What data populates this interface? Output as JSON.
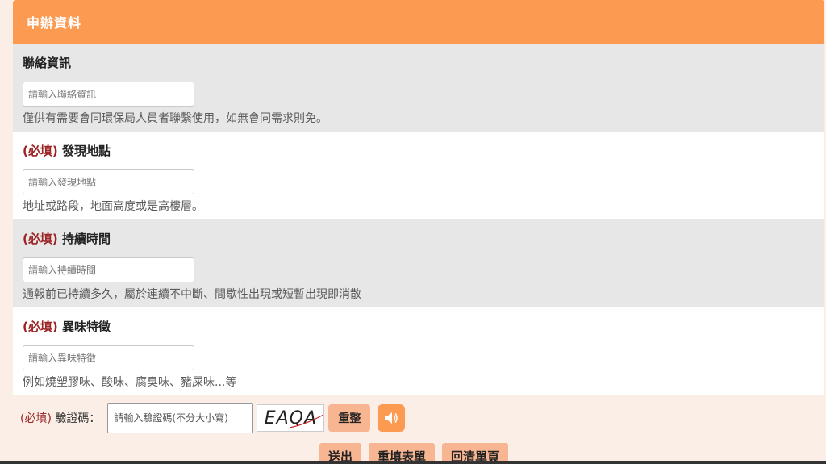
{
  "header": {
    "title": "申辦資料"
  },
  "fields": [
    {
      "required": false,
      "label": "聯絡資訊",
      "placeholder": "請輸入聯絡資訊",
      "value": "",
      "hint": "僅供有需要會同環保局人員者聯繫使用，如無會同需求則免。"
    },
    {
      "required": true,
      "label": "發現地點",
      "placeholder": "請輸入發現地點",
      "value": "",
      "hint": "地址或路段，地面高度或是高樓層。"
    },
    {
      "required": true,
      "label": "持續時間",
      "placeholder": "請輸入持續時間",
      "value": "",
      "hint": "通報前已持續多久，屬於連續不中斷、間歇性出現或短暫出現即消散"
    },
    {
      "required": true,
      "label": "異味特徵",
      "placeholder": "請輸入異味特徵",
      "value": "",
      "hint": "例如燒塑膠味、酸味、腐臭味、豬屎味...等"
    }
  ],
  "required_tag": "(必填)",
  "captcha": {
    "required_tag": "(必填)",
    "label": "驗證碼：",
    "placeholder": "請輸入驗證碼(不分大小寫)",
    "value": "",
    "image_text": "EAQA",
    "refresh_label": "重整",
    "audio_icon": "speaker-icon"
  },
  "actions": {
    "submit_label": "送出",
    "reset_label": "重填表單",
    "back_label": "回清單頁"
  },
  "colors": {
    "accent": "#fd9a52",
    "button_bg": "#f8b592",
    "required": "#9b2323"
  }
}
